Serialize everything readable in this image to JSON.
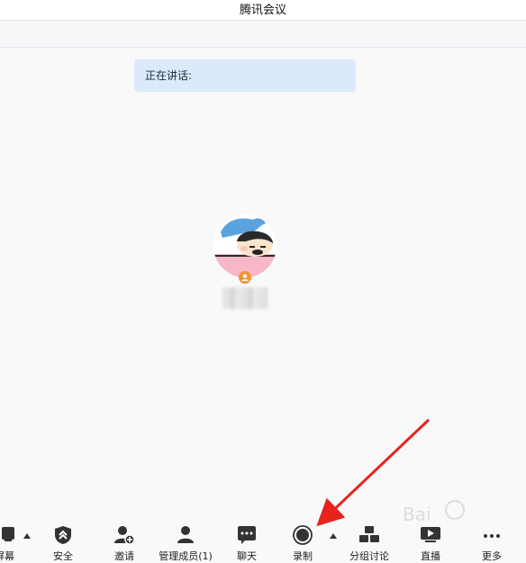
{
  "window": {
    "title": "腾讯会议"
  },
  "speaking": {
    "text": "正在讲话:"
  },
  "toolbar": {
    "items": [
      {
        "label": "屏幕",
        "icon": "share-screen-icon"
      },
      {
        "label": "安全",
        "icon": "shield-icon"
      },
      {
        "label": "邀请",
        "icon": "add-user-icon"
      },
      {
        "label": "管理成员(1)",
        "icon": "members-icon"
      },
      {
        "label": "聊天",
        "icon": "chat-icon"
      },
      {
        "label": "录制",
        "icon": "record-icon"
      },
      {
        "label": "分组讨论",
        "icon": "breakout-icon"
      },
      {
        "label": "直播",
        "icon": "live-icon"
      },
      {
        "label": "更多",
        "icon": "more-icon"
      }
    ]
  },
  "colors": {
    "speaking_bg": "#dbe9fb",
    "arrow": "#e8231b",
    "background": "#f9f9fa"
  }
}
